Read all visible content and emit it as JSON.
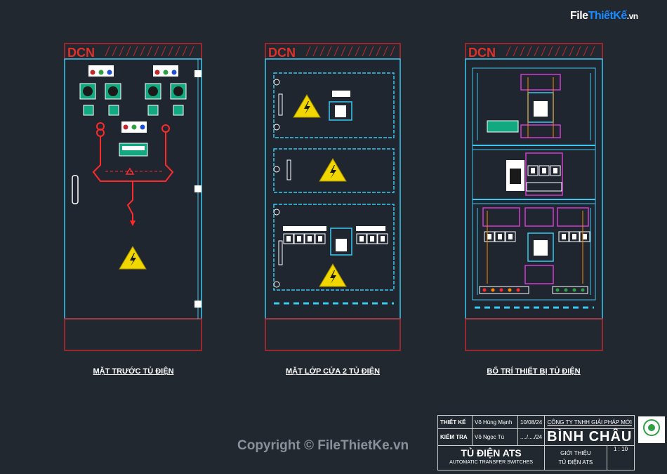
{
  "site_logo": {
    "file": "File",
    "thiet": "ThiếtKế",
    "vn": ".vn"
  },
  "panels": [
    {
      "brand": "DCN",
      "caption": "MẶT TRƯỚC TỦ ĐIỆN"
    },
    {
      "brand": "DCN",
      "caption": "MẶT LỚP CỬA 2 TỦ ĐIỆN"
    },
    {
      "brand": "DCN",
      "caption": "BỐ TRÍ THIẾT BỊ TỦ ĐIỆN"
    }
  ],
  "watermark": "Copyright © FileThietKe.vn",
  "title_block": {
    "designer_label": "THIẾT KẾ",
    "designer_name": "Võ Hùng Mạnh",
    "designer_date": "10/08/24",
    "checker_label": "KIỂM TRA",
    "checker_name": "Võ Ngọc Tú",
    "checker_date": "..../..../24",
    "company_line": "CÔNG TY TNHH GIẢI PHÁP MỚI",
    "company_name": "BÌNH CHÂU",
    "project_title": "TỦ ĐIỆN ATS",
    "project_subtitle": "AUTOMATIC TRANSFER SWITCHES",
    "sheet_line1": "GIỚI THIỆU",
    "sheet_line2": "TỦ ĐIỆN ATS",
    "scale": "1 : 10"
  },
  "colors": {
    "background": "#212830",
    "outline": "#c0282d",
    "cyan": "#3cc8f0",
    "warning": "#f2d600"
  }
}
